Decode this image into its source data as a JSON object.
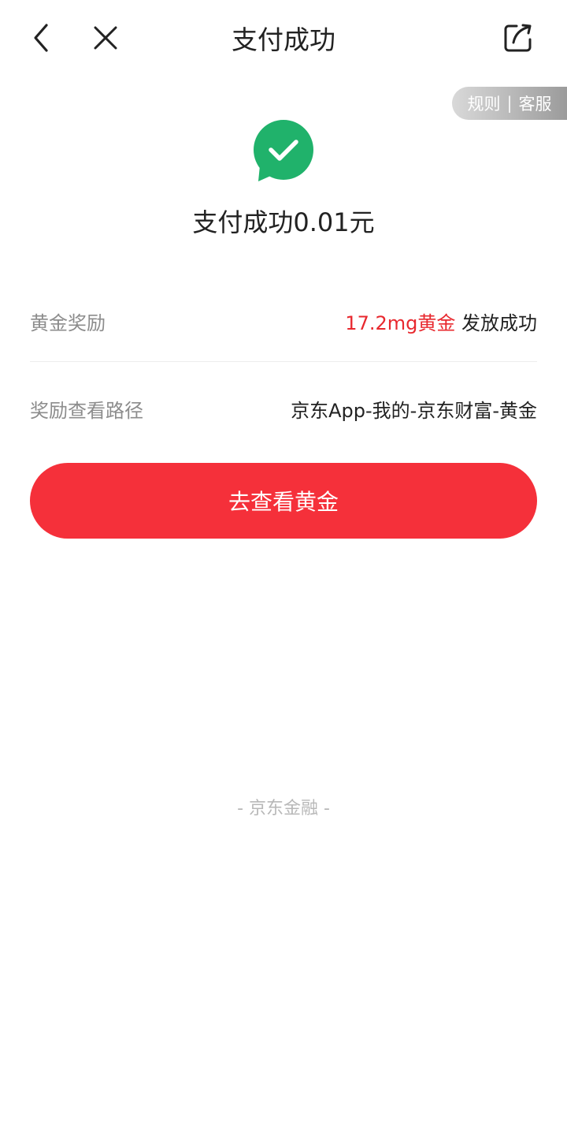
{
  "nav": {
    "title": "支付成功",
    "back_icon": "chevron-left-icon",
    "close_icon": "close-icon",
    "share_icon": "share-icon"
  },
  "top_actions": {
    "rules_label": "规则",
    "separator": "|",
    "service_label": "客服"
  },
  "status": {
    "icon": "check-chat-bubble-icon",
    "icon_color": "#20b26b",
    "message": "支付成功0.01元"
  },
  "rewards": {
    "gold_label": "黄金奖励",
    "gold_amount": "17.2mg黄金",
    "gold_status": " 发放成功",
    "path_label": "奖励查看路径",
    "path_value": "京东App-我的-京东财富-黄金"
  },
  "cta": {
    "label": "去查看黄金",
    "color": "#f5303a"
  },
  "footer": {
    "brand": "- 京东金融 -"
  },
  "colors": {
    "highlight": "#e8282e",
    "muted": "#8c8c8c"
  }
}
